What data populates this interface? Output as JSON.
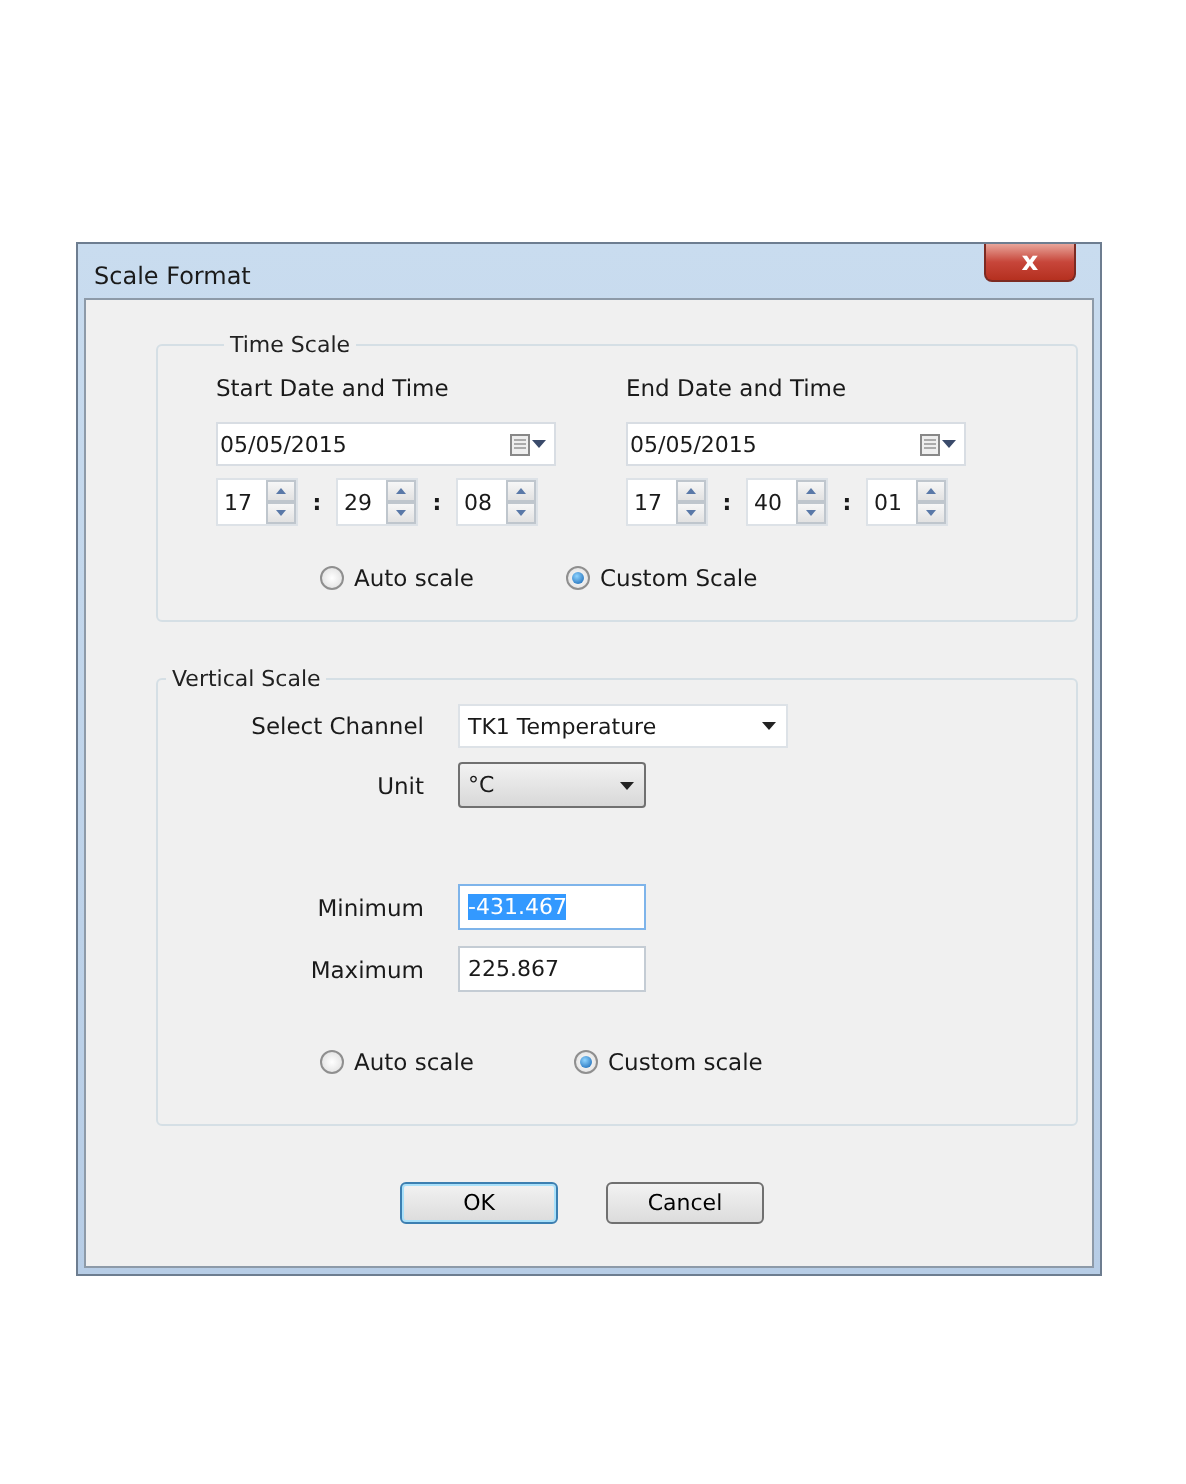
{
  "window": {
    "title": "Scale Format",
    "close_label": "x"
  },
  "time_scale": {
    "title": "Time Scale",
    "columns": [
      {
        "label": "Start Date and Time",
        "date": "05/05/2015",
        "time": [
          {
            "value": "17"
          },
          {
            "value": "29"
          },
          {
            "value": "08"
          }
        ],
        "separator": ":"
      },
      {
        "label": "End Date and Time",
        "date": "05/05/2015",
        "time": [
          {
            "value": "17"
          },
          {
            "value": "40"
          },
          {
            "value": "01"
          }
        ],
        "separator": ":"
      }
    ],
    "radios": [
      {
        "label": "Auto scale",
        "selected": false
      },
      {
        "label": "Custom Scale",
        "selected": true
      }
    ]
  },
  "vertical_scale": {
    "title": "Vertical Scale",
    "channel": {
      "label": "Select Channel",
      "value": "TK1 Temperature"
    },
    "unit": {
      "label": "Unit",
      "value": "°C"
    },
    "fields": [
      {
        "label": "Minimum",
        "value": "-431.467",
        "selected": true
      },
      {
        "label": "Maximum",
        "value": "225.867",
        "selected": false
      }
    ],
    "radios": [
      {
        "label": "Auto scale",
        "selected": false
      },
      {
        "label": "Custom scale",
        "selected": true
      }
    ]
  },
  "buttons": [
    {
      "label": "OK",
      "default": true
    },
    {
      "label": "Cancel",
      "default": false
    }
  ]
}
